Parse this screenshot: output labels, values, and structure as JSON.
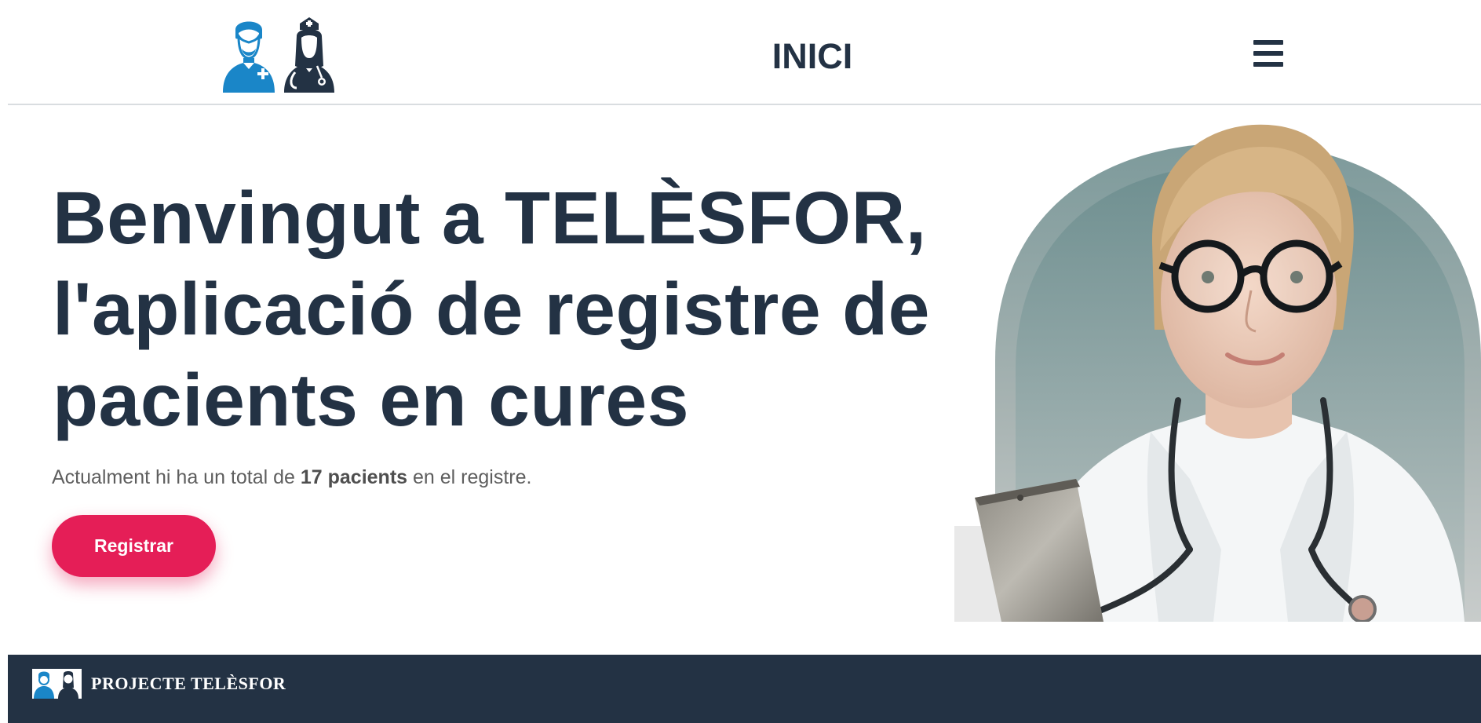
{
  "header": {
    "logo_icon": "doctor-and-nurse-logo",
    "nav_title": "INICI",
    "menu_icon": "hamburger-menu-icon"
  },
  "hero": {
    "title_lines": [
      "Benvingut a TELÈSFOR,",
      "l'aplicació de registre de",
      "pacients en cures"
    ],
    "text_before": "Actualment hi ha un total de ",
    "text_bold": "17 pacients",
    "text_after": " en el registre.",
    "register_label": "Registrar",
    "image_icon": "doctor-photo"
  },
  "footer": {
    "logo_icon": "doctor-and-nurse-logo",
    "title": "PROJECTE TELÈSFOR"
  },
  "colors": {
    "navy": "#233244",
    "doctor_blue": "#1a86c8",
    "accent_pink": "#e51e57",
    "text_gray": "#5e5e5e"
  }
}
